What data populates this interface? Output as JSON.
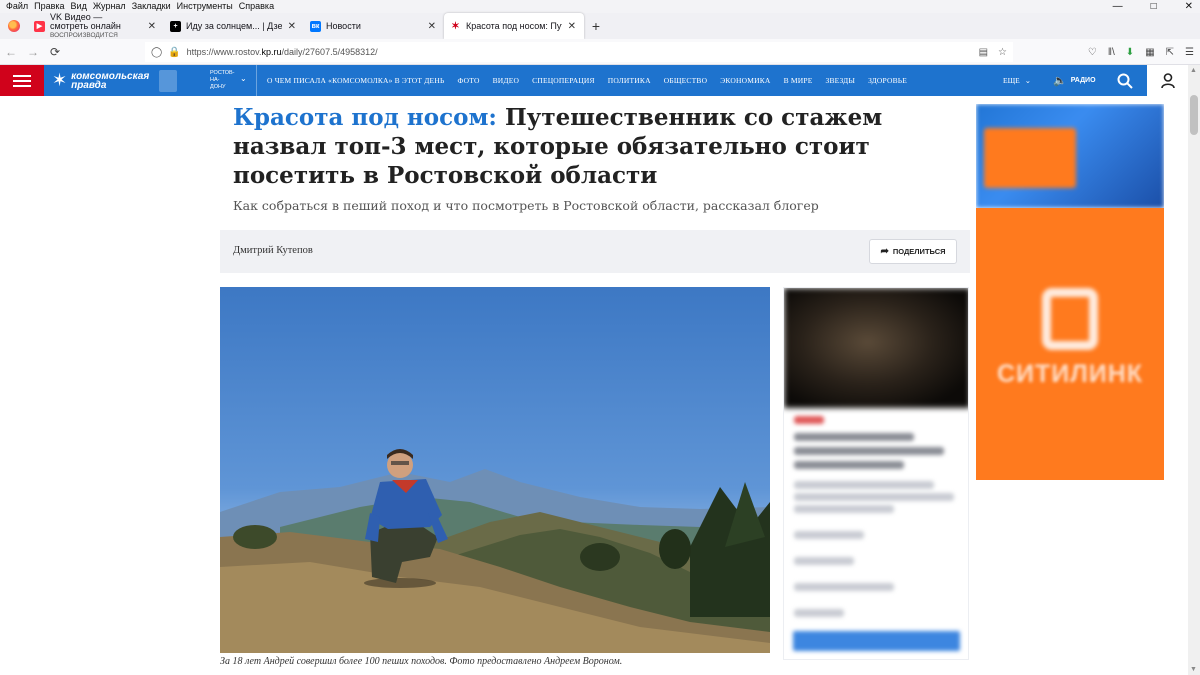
{
  "menubar": {
    "items": [
      "Файл",
      "Правка",
      "Вид",
      "Журнал",
      "Закладки",
      "Инструменты",
      "Справка"
    ]
  },
  "tabs": [
    {
      "title": "VK Видео — смотреть онлайн",
      "subtitle": "ВОСПРОИЗВОДИТСЯ",
      "favicon_color": "#ff3347"
    },
    {
      "title": "Иду за солнцем... | Дзен",
      "favicon_color": "#000000"
    },
    {
      "title": "Новости",
      "favicon_color": "#0077ff"
    },
    {
      "title": "Красота под носом: Путешеств",
      "favicon_color": "#d0021b",
      "active": true
    }
  ],
  "url": {
    "prefix": "https://www.rostov.",
    "domain": "kp.ru",
    "path": "/daily/27607.5/4958312/"
  },
  "site": {
    "brand_line1": "комсомольская",
    "brand_line2": "правда",
    "region": [
      "РОСТОВ-",
      "НА-",
      "ДОНУ"
    ],
    "nav": [
      "О ЧЕМ ПИСАЛА «КОМСОМОЛКА» В ЭТОТ ДЕНЬ",
      "ФОТО",
      "ВИДЕО",
      "СПЕЦОПЕРАЦИЯ",
      "ПОЛИТИКА",
      "ОБЩЕСТВО",
      "ЭКОНОМИКА",
      "В МИРЕ",
      "ЗВЕЗДЫ",
      "ЗДОРОВЬЕ"
    ],
    "more_label": "ЕЩЕ",
    "radio_label": "РАДИО",
    "accent": "#1e73ce",
    "burger_color": "#d0021b"
  },
  "article": {
    "rubric": "Красота под носом:",
    "title": "Путешественник со стажем назвал топ-3 мест, которые обязательно стоит посетить в Ростовской области",
    "lead": "Как собраться в пеший поход и что посмотреть в Ростовской области, рассказал блогер",
    "author": "Дмитрий Кутепов",
    "share_label": "ПОДЕЛИТЬСЯ",
    "caption": "За 18 лет Андрей совершил более 100 пеших походов. Фото предоставлено Андреем Вороном."
  },
  "ad": {
    "brand": "СИТИЛИНК",
    "color": "#ff7a1e"
  }
}
